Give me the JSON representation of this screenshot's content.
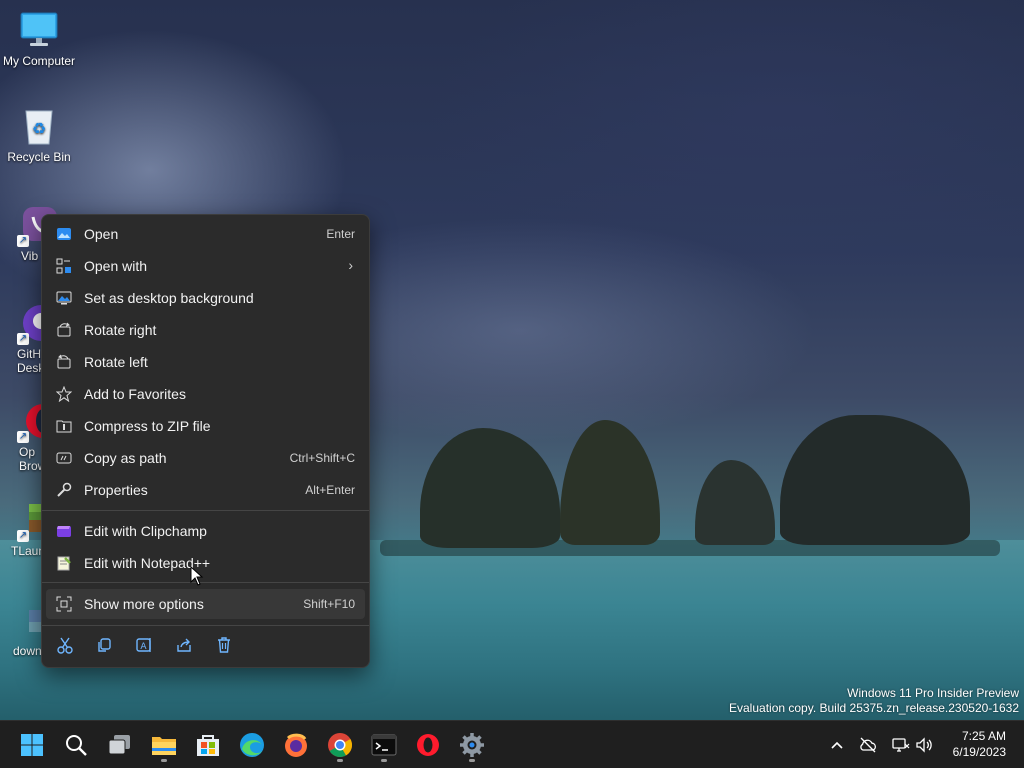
{
  "watermark": {
    "line1": "Windows 11 Pro Insider Preview",
    "line2": "Evaluation copy. Build 25375.zn_release.230520-1632"
  },
  "desktop_icons": [
    {
      "label": "My Computer",
      "icon": "monitor-icon"
    },
    {
      "label": "Recycle Bin",
      "icon": "recycle-bin-icon"
    },
    {
      "label": "Vib",
      "icon": "viber-icon"
    },
    {
      "label": "GitH Desk",
      "icon": "github-desktop-icon"
    },
    {
      "label": "Op Brow",
      "icon": "opera-icon"
    },
    {
      "label": "TLaun",
      "icon": "tlauncher-icon"
    },
    {
      "label": "down",
      "icon": "image-file-icon"
    }
  ],
  "context_menu": {
    "items": [
      {
        "label": "Open",
        "shortcut": "Enter",
        "icon": "image-open-icon"
      },
      {
        "label": "Open with",
        "shortcut": "",
        "icon": "open-with-icon",
        "submenu": true
      },
      {
        "label": "Set as desktop background",
        "shortcut": "",
        "icon": "desktop-background-icon"
      },
      {
        "label": "Rotate right",
        "shortcut": "",
        "icon": "rotate-right-icon"
      },
      {
        "label": "Rotate left",
        "shortcut": "",
        "icon": "rotate-left-icon"
      },
      {
        "label": "Add to Favorites",
        "shortcut": "",
        "icon": "star-icon"
      },
      {
        "label": "Compress to ZIP file",
        "shortcut": "",
        "icon": "zip-icon"
      },
      {
        "label": "Copy as path",
        "shortcut": "Ctrl+Shift+C",
        "icon": "copy-path-icon"
      },
      {
        "label": "Properties",
        "shortcut": "Alt+Enter",
        "icon": "wrench-icon"
      },
      {
        "label": "Edit with Clipchamp",
        "shortcut": "",
        "icon": "clipchamp-icon"
      },
      {
        "label": "Edit with Notepad++",
        "shortcut": "",
        "icon": "notepad-plus-plus-icon"
      },
      {
        "label": "Show more options",
        "shortcut": "Shift+F10",
        "icon": "more-options-icon"
      }
    ],
    "quick_actions": [
      "cut-icon",
      "copy-icon",
      "rename-icon",
      "share-icon",
      "delete-icon"
    ]
  },
  "taskbar": {
    "apps": [
      "start-icon",
      "search-icon",
      "task-view-icon",
      "file-explorer-icon",
      "microsoft-store-icon",
      "edge-icon",
      "firefox-icon",
      "chrome-icon",
      "terminal-icon",
      "opera-icon",
      "settings-icon"
    ],
    "tray": [
      "chevron-up-icon",
      "cloud-offline-icon",
      "network-icon",
      "volume-icon"
    ],
    "time": "7:25 AM",
    "date": "6/19/2023"
  },
  "colors": {
    "menu_bg": "#2b2b2b",
    "menu_hover": "#383838",
    "taskbar_bg": "#1f1f1f",
    "accent": "#0078d4"
  }
}
